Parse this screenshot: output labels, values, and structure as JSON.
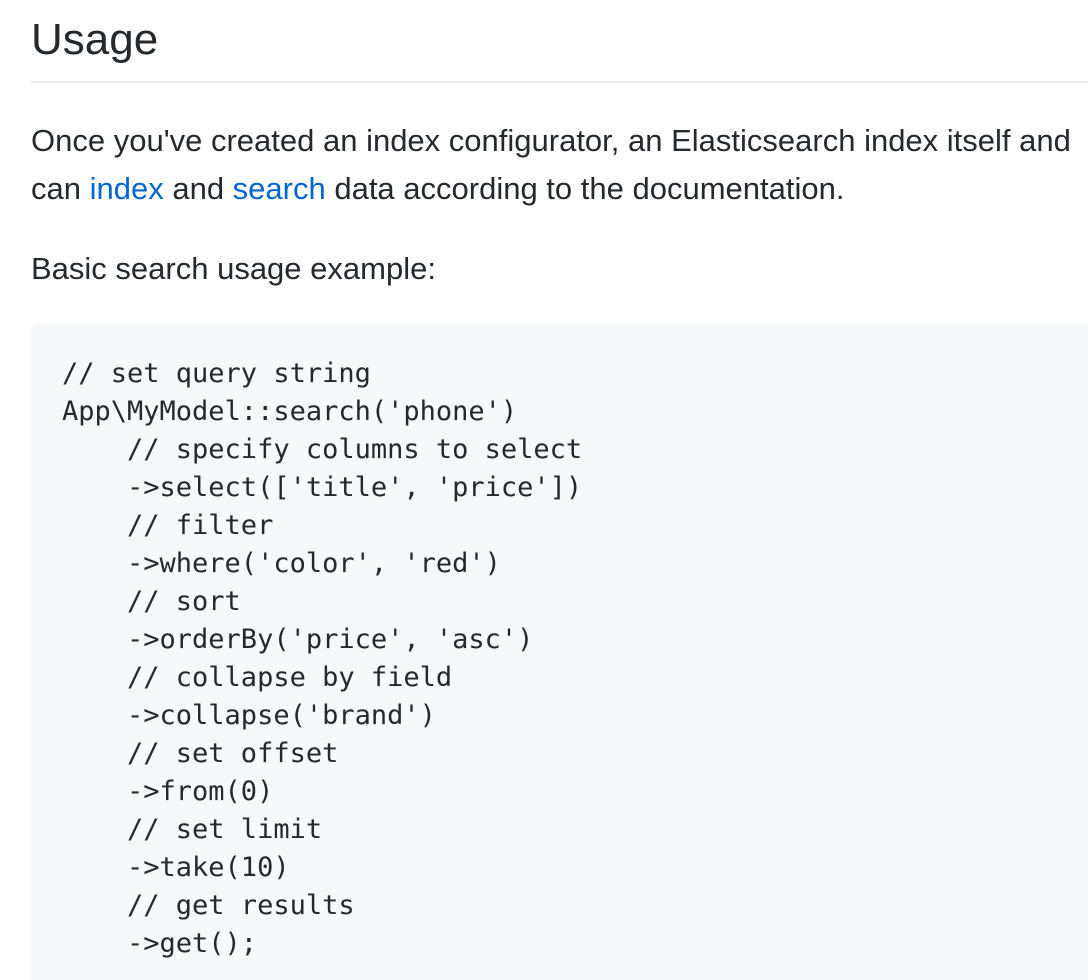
{
  "heading": "Usage",
  "intro": {
    "line1": "Once you've created an index configurator, an Elasticsearch index itself and",
    "line2_prefix": "can ",
    "index_link": "index",
    "and_text": " and ",
    "search_link": "search",
    "line2_suffix": " data according to the documentation."
  },
  "example_label": "Basic search usage example:",
  "code": {
    "lines": [
      "// set query string",
      "App\\MyModel::search('phone')",
      "    // specify columns to select",
      "    ->select(['title', 'price'])",
      "    // filter",
      "    ->where('color', 'red')",
      "    // sort",
      "    ->orderBy('price', 'asc')",
      "    // collapse by field",
      "    ->collapse('brand')",
      "    // set offset",
      "    ->from(0)",
      "    // set limit",
      "    ->take(10)",
      "    // get results",
      "    ->get();"
    ]
  },
  "colors": {
    "text": "#24292e",
    "link": "#0366d6",
    "code_background": "#f6f8fa",
    "rule": "#eaecef"
  }
}
